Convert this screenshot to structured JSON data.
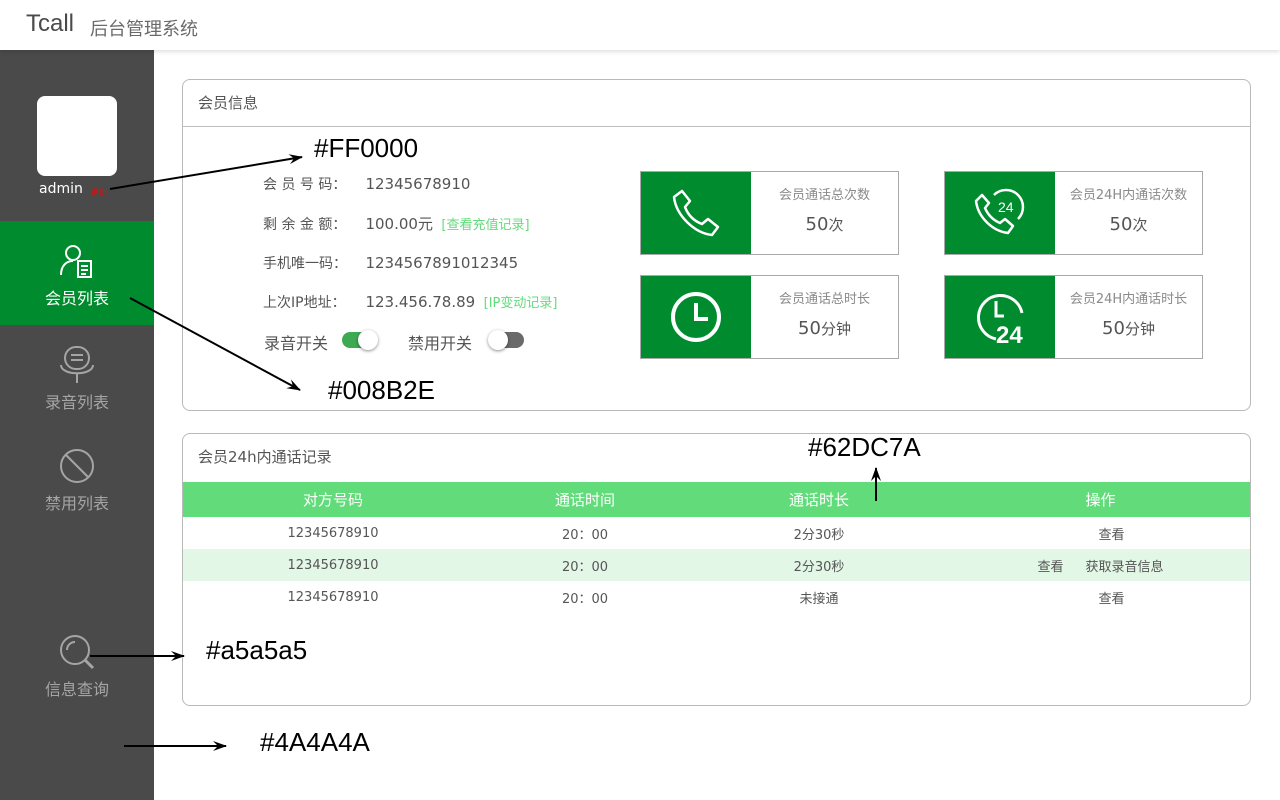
{
  "header": {
    "brand": "Tcall",
    "subtitle": "后台管理系统"
  },
  "sidebar": {
    "user": {
      "name": "admin",
      "status": "退出"
    },
    "items": [
      {
        "label": "会员列表",
        "icon": "member-list-icon",
        "active": true
      },
      {
        "label": "录音列表",
        "icon": "microphone-icon",
        "active": false
      },
      {
        "label": "禁用列表",
        "icon": "ban-icon",
        "active": false
      },
      {
        "label": "信息查询",
        "icon": "search-icon",
        "active": false
      }
    ]
  },
  "member_panel": {
    "title": "会员信息",
    "fields": [
      {
        "label": "会 员 号 码：",
        "value": "12345678910",
        "link": ""
      },
      {
        "label": "剩 余 金 额：",
        "value": "100.00元",
        "link": "[查看充值记录]"
      },
      {
        "label": "手机唯一码：",
        "value": "1234567891012345",
        "link": ""
      },
      {
        "label": "上次IP地址：",
        "value": "123.456.78.89",
        "link": "[IP变动记录]"
      }
    ],
    "toggles": [
      {
        "label": "录音开关",
        "on": true
      },
      {
        "label": "禁用开关",
        "on": false
      }
    ],
    "stats": [
      {
        "title": "会员通话总次数",
        "value": "50",
        "unit": "次",
        "icon": "phone-icon"
      },
      {
        "title": "会员24H内通话次数",
        "value": "50",
        "unit": "次",
        "icon": "phone-24h-icon"
      },
      {
        "title": "会员通话总时长",
        "value": "50",
        "unit": "分钟",
        "icon": "clock-icon"
      },
      {
        "title": "会员24H内通话时长",
        "value": "50",
        "unit": "分钟",
        "icon": "clock-24-icon"
      }
    ]
  },
  "calls_panel": {
    "title": "会员24h内通话记录",
    "columns": [
      "对方号码",
      "通话时间",
      "通话时长",
      "操作"
    ],
    "rows": [
      {
        "number": "12345678910",
        "time": "20：00",
        "duration": "2分30秒",
        "op1": "",
        "op2": "查看"
      },
      {
        "number": "12345678910",
        "time": "20：00",
        "duration": "2分30秒",
        "op1": "查看",
        "op2": "获取录音信息"
      },
      {
        "number": "12345678910",
        "time": "20：00",
        "duration": "未接通",
        "op1": "",
        "op2": "查看"
      }
    ]
  },
  "annotations": {
    "red": "#FF0000",
    "green": "#008B2E",
    "light_green": "#62DC7A",
    "gray": "#a5a5a5",
    "dark_gray": "#4A4A4A"
  },
  "colors": {
    "sidebar_bg": "#4A4A4A",
    "active": "#008B2E",
    "table_header": "#62DC7A",
    "nav_text": "#a5a5a5",
    "logout": "#FF0000"
  }
}
